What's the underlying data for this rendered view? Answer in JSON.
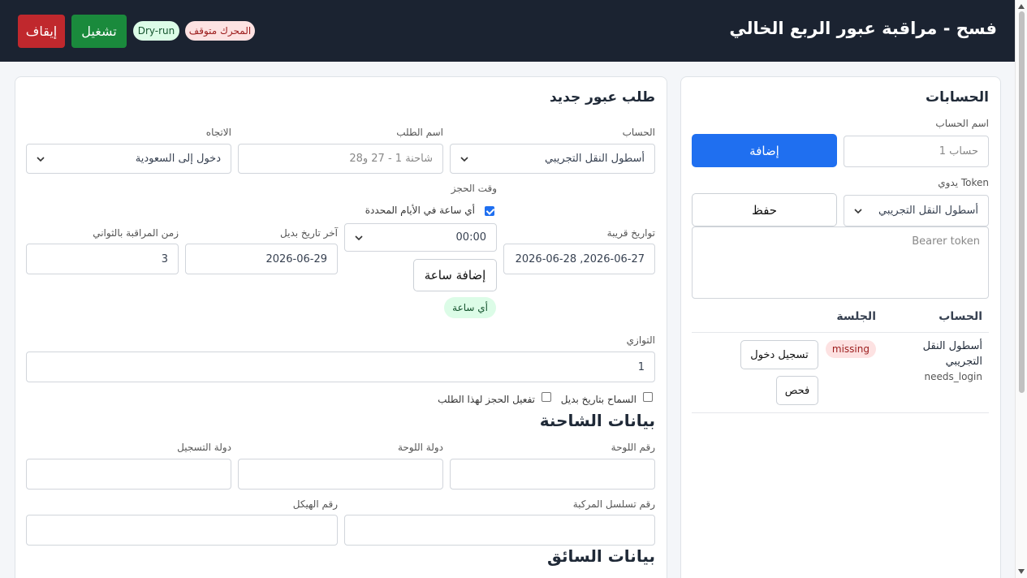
{
  "header": {
    "title": "فسح - مراقبة عبور الربع الخالي",
    "stop_label": "إيقاف",
    "run_label": "تشغيل",
    "dry_run_label": "Dry-run",
    "engine_status": "المحرك متوقف"
  },
  "accounts": {
    "title": "الحسابات",
    "name_label": "اسم الحساب",
    "name_placeholder": "حساب 1",
    "add_label": "إضافة",
    "token_label": "Token يدوي",
    "token_account_selected": "أسطول النقل التجريبي",
    "save_label": "حفظ",
    "token_placeholder": "Bearer token",
    "table": {
      "col_account": "الحساب",
      "col_session": "الجلسة",
      "rows": [
        {
          "name_line1": "أسطول النقل",
          "name_line2": "التجريبي",
          "status": "needs_login",
          "session": "missing",
          "login_label": "تسجيل دخول",
          "check_label": "فحص"
        }
      ]
    }
  },
  "request": {
    "title": "طلب عبور جديد",
    "account_label": "الحساب",
    "account_selected": "أسطول النقل التجريبي",
    "name_label": "اسم الطلب",
    "name_placeholder": "شاحنة 1 - 27 و28",
    "direction_label": "الاتجاه",
    "direction_selected": "دخول إلى السعودية",
    "booking_time_label": "وقت الحجز",
    "any_time_label": "أي ساعة في الأيام المحددة",
    "any_time_checked": true,
    "nearby_dates_label": "تواريخ قريبة",
    "nearby_dates_value": "2026-06-27, 2026-06-28",
    "time_selected": "00:00",
    "add_time_label": "إضافة ساعة",
    "any_hour_badge": "أي ساعة",
    "last_alt_date_label": "آخر تاريخ بديل",
    "last_alt_date_value": "2026-06-29",
    "monitor_seconds_label": "زمن المراقبة بالثواني",
    "monitor_seconds_value": "3",
    "parallel_label": "التوازي",
    "parallel_value": "1",
    "allow_alt_date_label": "السماح بتاريخ بديل",
    "allow_alt_date_checked": false,
    "enable_booking_label": "تفعيل الحجز لهذا الطلب",
    "enable_booking_checked": false
  },
  "truck": {
    "title": "بيانات الشاحنة",
    "plate_number_label": "رقم اللوحة",
    "plate_country_label": "دولة اللوحة",
    "registration_country_label": "دولة التسجيل",
    "vehicle_serial_label": "رقم تسلسل المركبة",
    "chassis_number_label": "رقم الهيكل"
  },
  "driver": {
    "title": "بيانات السائق"
  },
  "colors": {
    "header_bg": "#1b2331",
    "primary": "#1f6ff0",
    "danger": "#c0282d",
    "success": "#1a8a3c"
  }
}
